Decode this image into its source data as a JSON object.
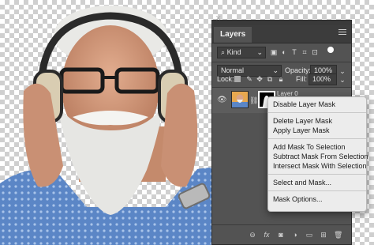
{
  "panel": {
    "tab_label": "Layers",
    "filter_value": "Kind",
    "blend_mode": "Normal",
    "opacity_label": "Opacity:",
    "opacity_value": "100%",
    "lock_label": "Lock:",
    "fill_label": "Fill:",
    "fill_value": "100%",
    "layer_name": "Layer 0"
  },
  "context_menu": {
    "groups": [
      [
        "Disable Layer Mask"
      ],
      [
        "Delete Layer Mask",
        "Apply Layer Mask"
      ],
      [
        "Add Mask To Selection",
        "Subtract Mask From Selection",
        "Intersect Mask With Selection"
      ],
      [
        "Select and Mask..."
      ],
      [
        "Mask Options..."
      ]
    ]
  },
  "icons": {
    "filter": [
      "image-filter-icon",
      "adjustment-filter-icon",
      "type-filter-icon",
      "shape-filter-icon",
      "smart-object-filter-icon",
      "toggle-filter-icon"
    ],
    "lock": [
      "lock-transparent-icon",
      "lock-image-icon",
      "lock-position-icon",
      "lock-artboard-icon",
      "lock-all-icon"
    ],
    "bottom": [
      "link-layers-icon",
      "fx-icon",
      "add-mask-icon",
      "new-adjustment-icon",
      "new-group-icon",
      "new-layer-icon",
      "delete-layer-icon"
    ]
  },
  "colors": {
    "panel_bg": "#535353",
    "menu_bg": "#ececec",
    "shirt_blue": "#5b86c6"
  }
}
